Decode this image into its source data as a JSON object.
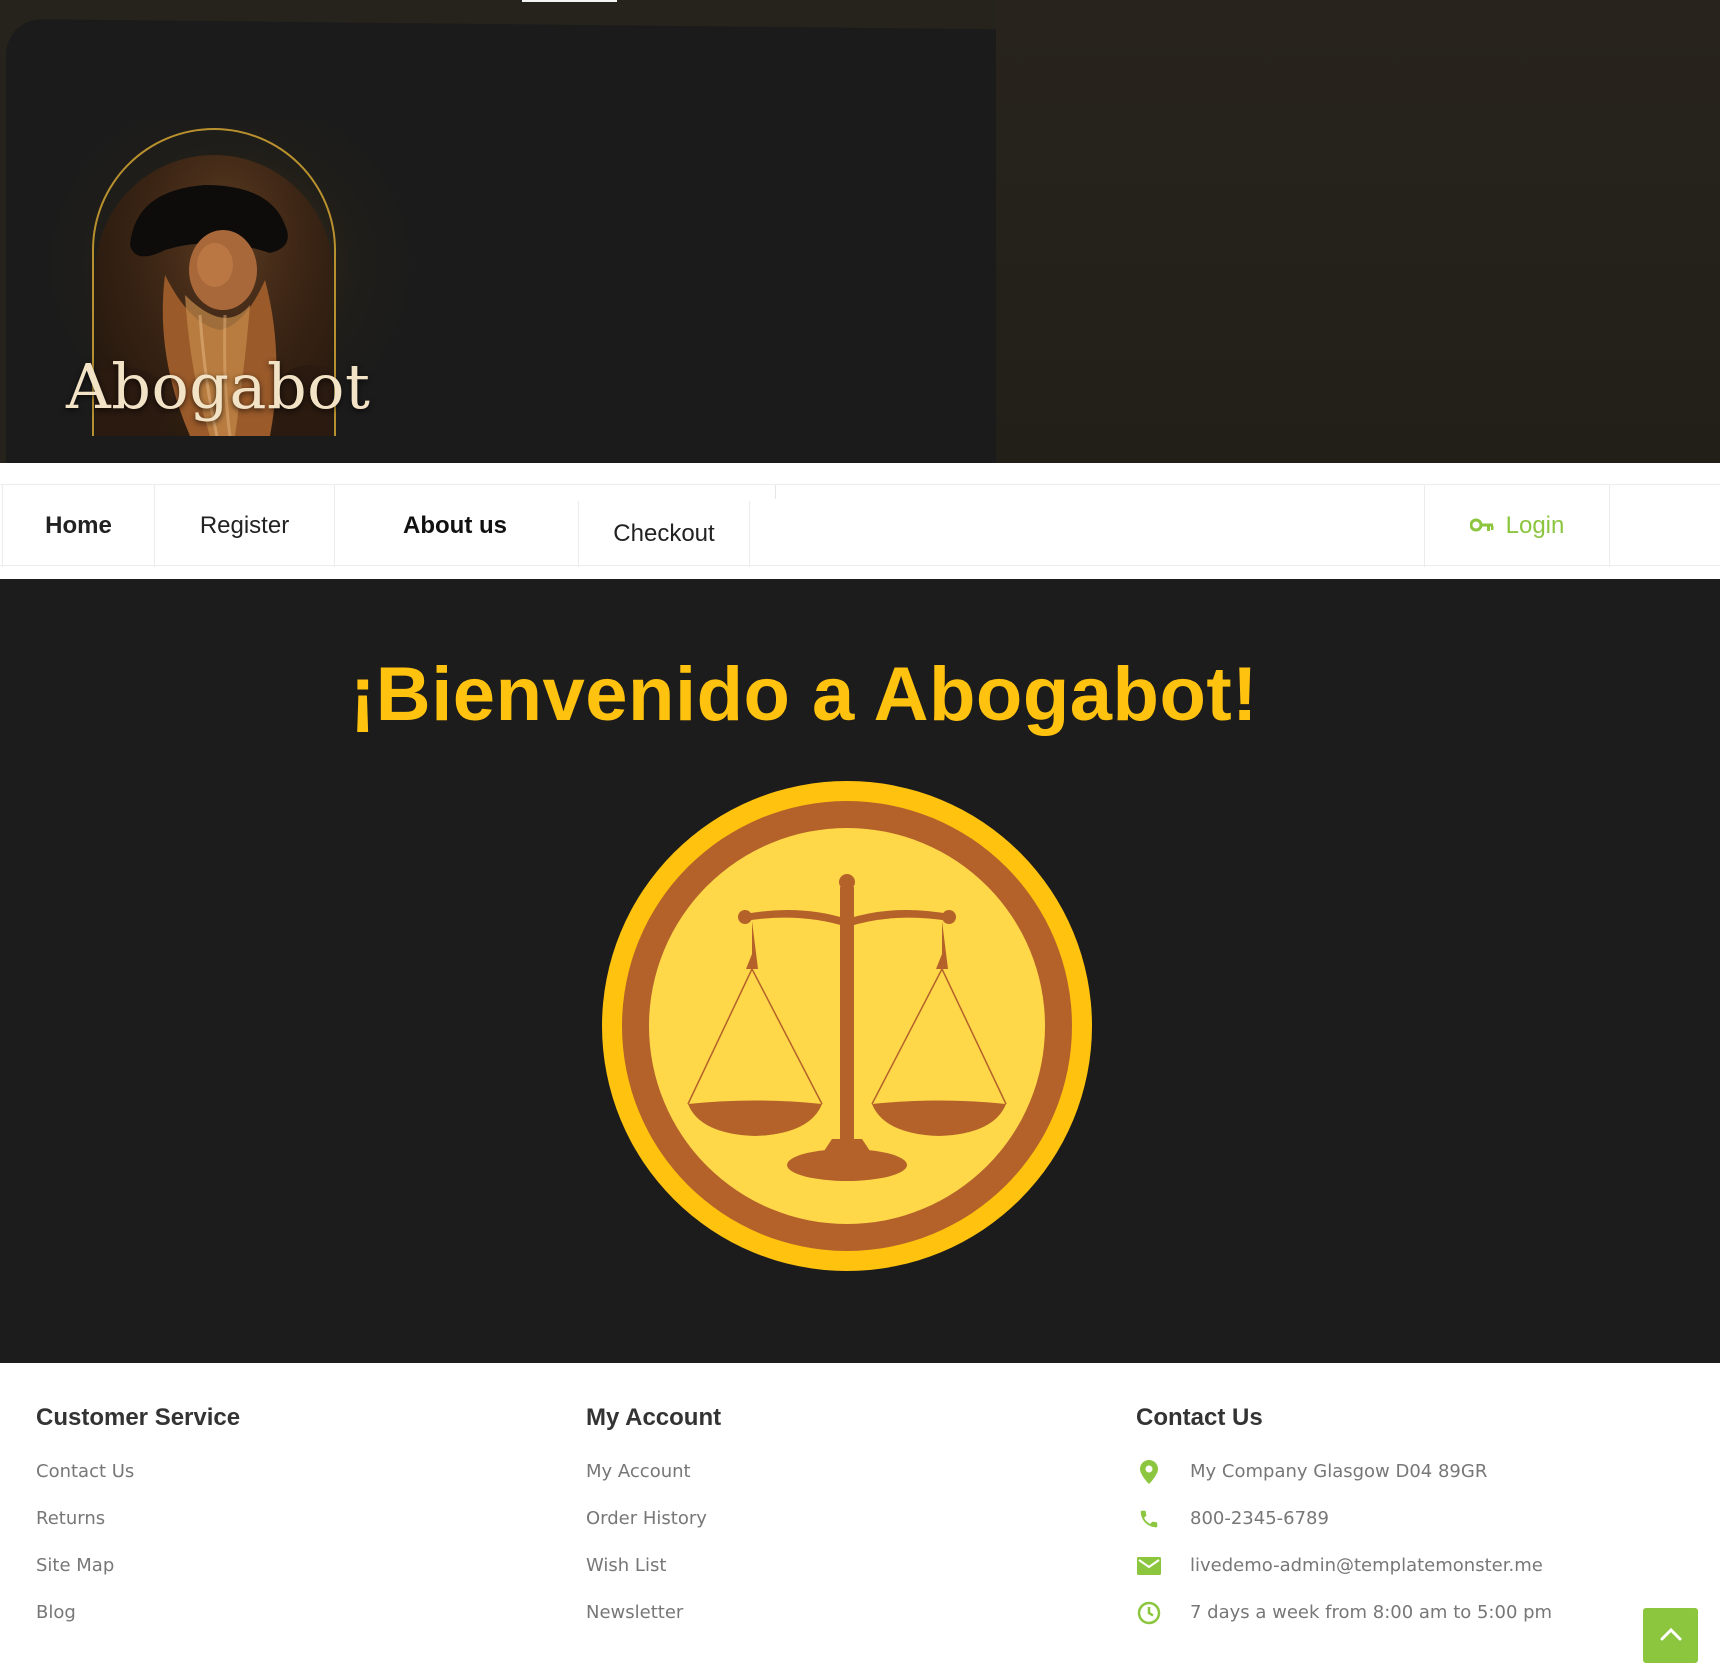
{
  "header": {
    "logo_text": "Abogabot"
  },
  "nav": {
    "items": [
      {
        "label": "Home"
      },
      {
        "label": "Register"
      },
      {
        "label": "About us"
      },
      {
        "label": "Checkout"
      }
    ],
    "login_label": "Login"
  },
  "hero": {
    "title": "¡Bienvenido a Abogabot!",
    "emblem_icon": "scales-of-justice-icon"
  },
  "footer": {
    "customer_service": {
      "heading": "Customer Service",
      "links": [
        "Contact Us",
        "Returns",
        "Site Map",
        "Blog"
      ]
    },
    "my_account": {
      "heading": "My Account",
      "links": [
        "My Account",
        "Order History",
        "Wish List",
        "Newsletter"
      ]
    },
    "contact_us": {
      "heading": "Contact Us",
      "address": "My Company Glasgow D04 89GR",
      "phone": "800-2345-6789",
      "email": "livedemo-admin@templatemonster.me",
      "hours": "7 days a week from 8:00 am to 5:00 pm"
    }
  },
  "colors": {
    "accent": "#8cc63f",
    "hero_title": "#ffc20e",
    "emblem_outer": "#ffc20e",
    "emblem_ring": "#b5622a",
    "emblem_inner": "#ffd84a",
    "hero_background": "#1c1c1c"
  }
}
